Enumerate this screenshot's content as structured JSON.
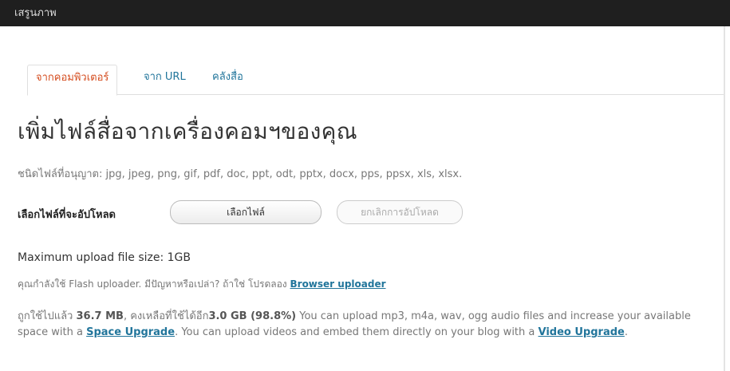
{
  "window": {
    "title": "เสรูนภาพ"
  },
  "tabs": [
    {
      "label": "จากคอมพิวเตอร์",
      "active": true
    },
    {
      "label": "จาก URL",
      "active": false
    },
    {
      "label": "คลังสื่อ",
      "active": false
    }
  ],
  "main": {
    "heading": "เพิ่มไฟล์สื่อจากเครื่องคอมฯของคุณ",
    "allowed_types": "ชนิดไฟล์ที่อนุญาต: jpg, jpeg, png, gif, pdf, doc, ppt, odt, pptx, docx, pps, ppsx, xls, xlsx.",
    "pick_label": "เลือกไฟล์ที่จะอัปโหลด",
    "choose_button": "เลือกไฟล์",
    "cancel_button": "ยกเลิกการอัปโหลด",
    "max_upload": "Maximum upload file size: 1GB",
    "flash_text": "คุณกำลังใช้ Flash uploader. มีปัญหาหรือเปล่า? ถ้าใช่ โปรดลอง",
    "flash_link": "Browser uploader",
    "quota": {
      "prefix": "ถูกใช้ไปแล้ว",
      "used": "36.7 MB",
      "remain_text": ", คงเหลือที่ใช้ได้อีก",
      "remain": "3.0 GB (98.8%)",
      "text1": " You can upload mp3, m4a, wav, ogg audio files and increase your available space with a ",
      "link1": "Space Upgrade",
      "text2": ". You can upload videos and embed them directly on your blog with a ",
      "link2": "Video Upgrade",
      "text3": "."
    }
  }
}
